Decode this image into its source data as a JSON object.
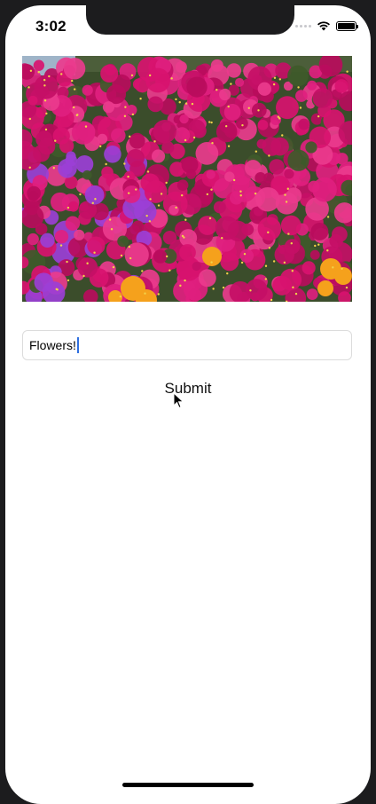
{
  "status_bar": {
    "time": "3:02"
  },
  "image": {
    "icon": "flowers-photo",
    "description_visible": ""
  },
  "form": {
    "text_field_value": "Flowers!",
    "submit_label": "Submit"
  },
  "colors": {
    "accent_caret": "#2f6fe0",
    "flower_magenta": "#d8126f",
    "flower_purple": "#9b3fd6",
    "flower_orange": "#f5a11c",
    "foliage": "#3f5a2a"
  }
}
